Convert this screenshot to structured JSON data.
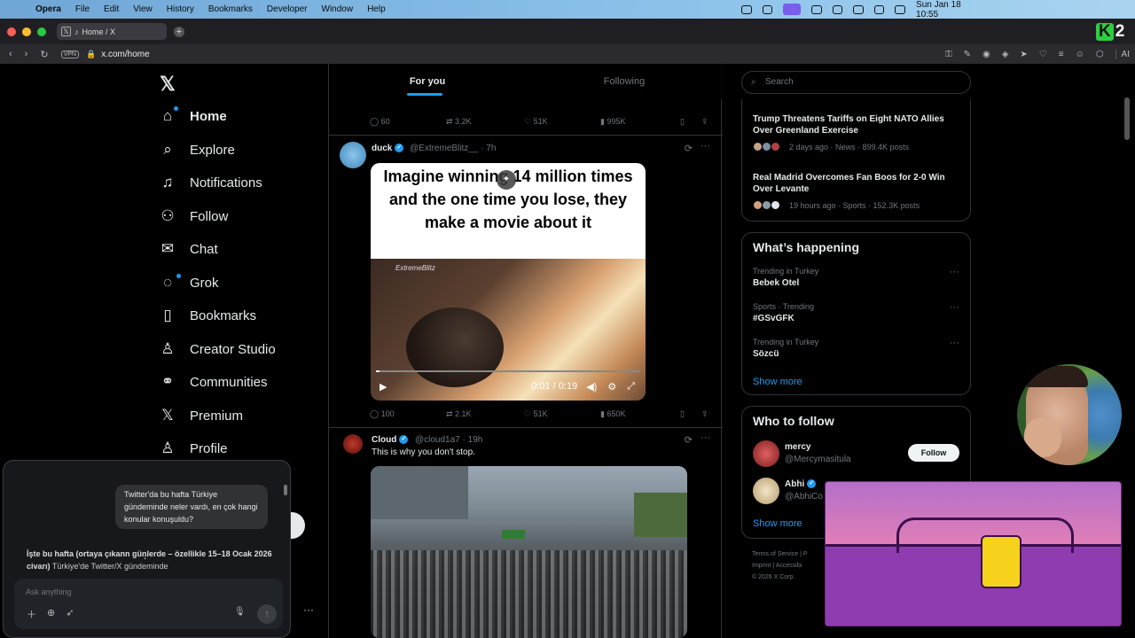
{
  "menubar": {
    "app": "Opera",
    "items": [
      "File",
      "Edit",
      "View",
      "History",
      "Bookmarks",
      "Developer",
      "Window",
      "Help"
    ],
    "datetime": "Sun Jan 18  10:55"
  },
  "browser": {
    "tab_title": "Home / X",
    "url": "x.com/home",
    "vpn": "VPN",
    "ai_label": "AI",
    "logo_letter": "K",
    "logo_number": "2"
  },
  "nav": {
    "items": [
      "Home",
      "Explore",
      "Notifications",
      "Follow",
      "Chat",
      "Grok",
      "Bookmarks",
      "Creator Studio",
      "Communities",
      "Premium",
      "Profile"
    ]
  },
  "feed": {
    "tabs": [
      "For you",
      "Following"
    ],
    "tweet0": {
      "replies": "60",
      "reposts": "3.2K",
      "likes": "51K",
      "views": "995K"
    },
    "tweet1": {
      "name": "duck",
      "handle": "@ExtremeBlitz__",
      "time": "· 7h",
      "meme_text": "Imagine winning 14 million times and the one time you lose, they make a movie about it",
      "watermark": "ExtremeBlitz",
      "video_time": "0:01 / 0:19",
      "replies": "100",
      "reposts": "2.1K",
      "likes": "51K",
      "views": "650K"
    },
    "tweet2": {
      "name": "Cloud",
      "handle": "@cloud1a7",
      "time": "· 19h",
      "text": "This is why you don't stop."
    }
  },
  "sidebar": {
    "search_placeholder": "Search",
    "news": [
      {
        "title": "Trump Threatens Tariffs on Eight NATO Allies Over Greenland Exercise",
        "meta": "2 days ago · News · 899.4K posts"
      },
      {
        "title": "Real Madrid Overcomes Fan Boos for 2-0 Win Over Levante",
        "meta": "19 hours ago · Sports · 152.3K posts"
      }
    ],
    "happening": {
      "title": "What’s happening",
      "trends": [
        {
          "context": "Trending in Turkey",
          "name": "Bebek Otel"
        },
        {
          "context": "Sports · Trending",
          "name": "#GSvGFK"
        },
        {
          "context": "Trending in Turkey",
          "name": "Sözcü"
        }
      ],
      "show_more": "Show more"
    },
    "who_to_follow": {
      "title": "Who to follow",
      "users": [
        {
          "name": "mercy",
          "handle": "@Mercymasitula",
          "button": "Follow"
        },
        {
          "name": "Abhi",
          "handle": "@AbhiCo"
        }
      ],
      "show_more": "Show more"
    },
    "footer": {
      "line1": "Terms of Service  |  P",
      "line2": "Imprint  |  Accessibi",
      "line3": "© 2026 X Corp."
    }
  },
  "grok": {
    "user_message": "Twitter'da bu hafta Türkiye gündeminde neler vardı, en çok hangi konular konuşuldu?",
    "answer_bold": "İşte bu hafta (ortaya çıkan",
    "answer_bold2": "n günlerde – özellikle 15–18 Ocak 2026 civarı)",
    "answer_rest": " Türkiye'de Twitter/X gündeminde",
    "input_placeholder": "Ask anything",
    "more": "···"
  }
}
